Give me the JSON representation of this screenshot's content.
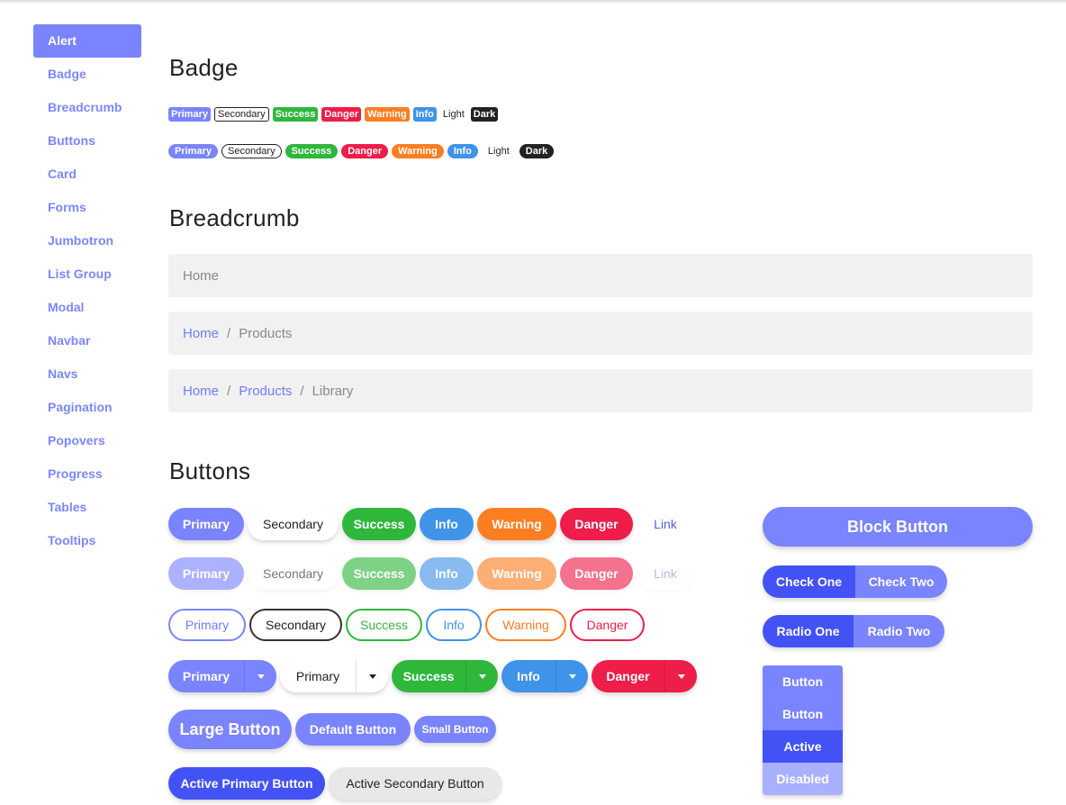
{
  "sidebar": {
    "items": [
      "Alert",
      "Badge",
      "Breadcrumb",
      "Buttons",
      "Card",
      "Forms",
      "Jumbotron",
      "List Group",
      "Modal",
      "Navbar",
      "Navs",
      "Pagination",
      "Popovers",
      "Progress",
      "Tables",
      "Tooltips"
    ],
    "active": "Alert"
  },
  "badge": {
    "title": "Badge",
    "labels": [
      "Primary",
      "Secondary",
      "Success",
      "Danger",
      "Warning",
      "Info",
      "Light",
      "Dark"
    ]
  },
  "breadcrumb": {
    "title": "Breadcrumb",
    "one": {
      "current": "Home"
    },
    "two": {
      "link1": "Home",
      "current": "Products"
    },
    "three": {
      "link1": "Home",
      "link2": "Products",
      "current": "Library"
    },
    "separator": "/"
  },
  "buttons": {
    "title": "Buttons",
    "labels": [
      "Primary",
      "Secondary",
      "Success",
      "Info",
      "Warning",
      "Danger",
      "Link"
    ],
    "outline_labels": [
      "Primary",
      "Secondary",
      "Success",
      "Info",
      "Warning",
      "Danger"
    ],
    "split_labels": [
      "Primary",
      "Primary",
      "Success",
      "Info",
      "Danger"
    ],
    "sizes": {
      "large": "Large Button",
      "default": "Default Button",
      "small": "Small Button"
    },
    "active": {
      "primary": "Active Primary Button",
      "secondary": "Active Secondary Button"
    },
    "block": "Block Button",
    "check": {
      "one": "Check One",
      "two": "Check Two"
    },
    "radio": {
      "one": "Radio One",
      "two": "Radio Two"
    },
    "vertical": [
      "Button",
      "Button",
      "Active",
      "Disabled"
    ]
  },
  "colors": {
    "primary": "#7a84ff",
    "success": "#2fb73c",
    "danger": "#ee1d49",
    "warning": "#fd7e21",
    "info": "#3f93e8",
    "dark": "#222222",
    "active_primary": "#4352f5"
  }
}
